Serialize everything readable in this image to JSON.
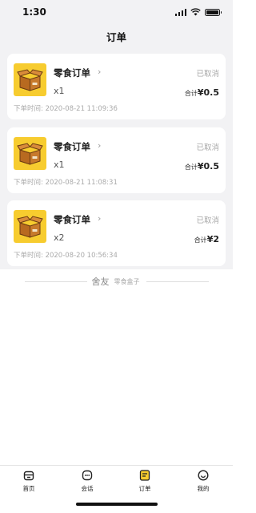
{
  "status_bar": {
    "time": "1:30",
    "signal_icon": "signal-icon",
    "wifi_icon": "wifi-icon",
    "battery_icon": "battery-icon"
  },
  "nav": {
    "title": "订单"
  },
  "orders": [
    {
      "name": "零食订单",
      "quantity": "x1",
      "status": "已取消",
      "total_label": "合计",
      "currency": "¥",
      "amount": "0.5",
      "time_label": "下单时间:",
      "time": "2020-08-21 11:09:36"
    },
    {
      "name": "零食订单",
      "quantity": "x1",
      "status": "已取消",
      "total_label": "合计",
      "currency": "¥",
      "amount": "0.5",
      "time_label": "下单时间:",
      "time": "2020-08-21 11:08:31"
    },
    {
      "name": "零食订单",
      "quantity": "x2",
      "status": "已取消",
      "total_label": "合计",
      "currency": "¥",
      "amount": "2",
      "time_label": "下单时间:",
      "time": "2020-08-20 10:56:34"
    }
  ],
  "footer": {
    "brand": "舍友",
    "sub": "零食盒子"
  },
  "tabs": [
    {
      "label": "首页",
      "icon": "home-icon"
    },
    {
      "label": "会话",
      "icon": "chat-icon"
    },
    {
      "label": "订单",
      "icon": "orders-icon"
    },
    {
      "label": "我的",
      "icon": "profile-icon"
    }
  ],
  "colors": {
    "accent": "#f7cc2f",
    "background": "#f2f2f4",
    "muted_text": "#aaaaaa"
  }
}
